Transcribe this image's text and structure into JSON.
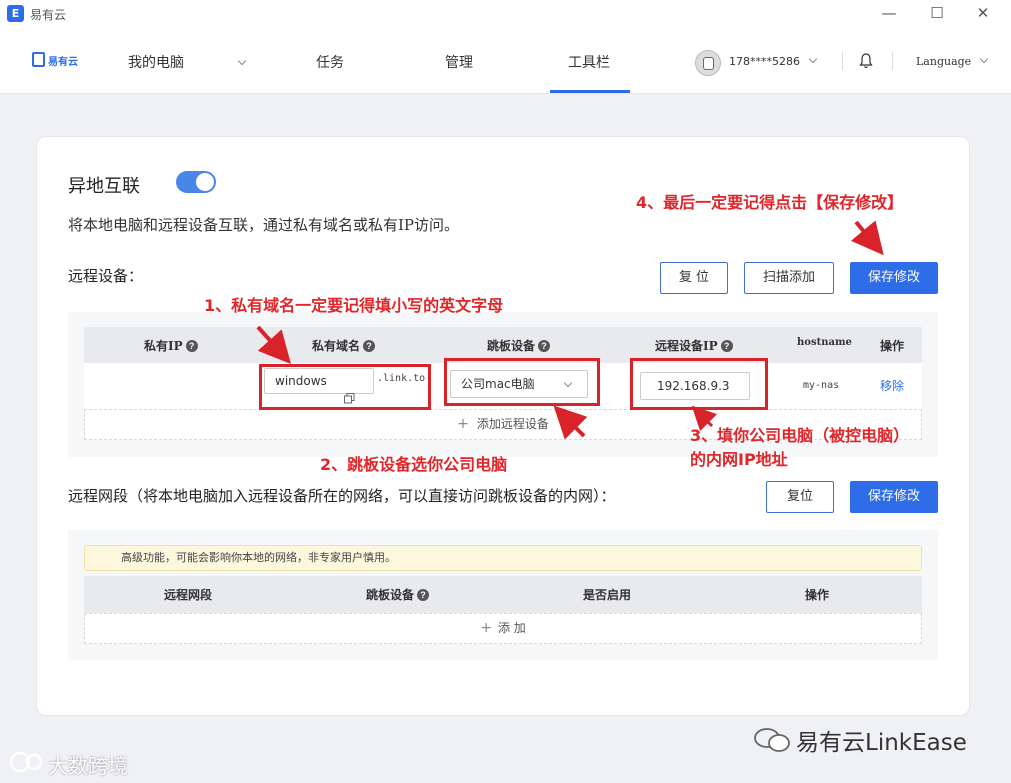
{
  "window": {
    "title": "易有云",
    "app_icon": "E",
    "controls": {
      "minimize": "—",
      "maximize": "☐",
      "close": "✕"
    }
  },
  "nav": {
    "logo_text": "易有云",
    "my_computer": "我的电脑",
    "tasks": "任务",
    "manage": "管理",
    "toolbar": "工具栏",
    "active_tab": "工具栏",
    "account": "178****5286",
    "language": "Language"
  },
  "section": {
    "title": "异地互联",
    "toggle_on": true,
    "description": "将本地电脑和远程设备互联，通过私有域名或私有IP访问。"
  },
  "remote_devices": {
    "title": "远程设备：",
    "reset_label": "复 位",
    "scan_add_label": "扫描添加",
    "save_label": "保存修改",
    "columns": [
      "私有IP",
      "私有域名",
      "跳板设备",
      "远程设备IP",
      "hostname",
      "操作"
    ],
    "row": {
      "private_ip": "",
      "domain": "windows",
      "domain_suffix": ".link.to",
      "jump_device": "公司mac电脑",
      "remote_ip": "192.168.9.3",
      "hostname": "my-nas",
      "action": "移除"
    },
    "add_label": "添加远程设备"
  },
  "remote_segments": {
    "title": "远程网段（将本地电脑加入远程设备所在的网络，可以直接访问跳板设备的内网）：",
    "reset_label": "复位",
    "save_label": "保存修改",
    "warning": "高级功能，可能会影响你本地的网络，非专家用户慎用。",
    "columns": [
      "远程网段",
      "跳板设备",
      "是否启用",
      "操作"
    ],
    "add_label": "添 加"
  },
  "annotations": {
    "a1": "1、私有域名一定要记得填小写的英文字母",
    "a2": "2、跳板设备选你公司电脑",
    "a3_line1": "3、填你公司电脑（被控电脑）",
    "a3_line2": "的内网IP地址",
    "a4": "4、最后一定要记得点击【保存修改】"
  },
  "watermarks": {
    "left": "大数跨境",
    "right": "易有云LinkEase"
  },
  "colors": {
    "accent": "#2f6de8",
    "annotation_red": "#d8232a"
  }
}
